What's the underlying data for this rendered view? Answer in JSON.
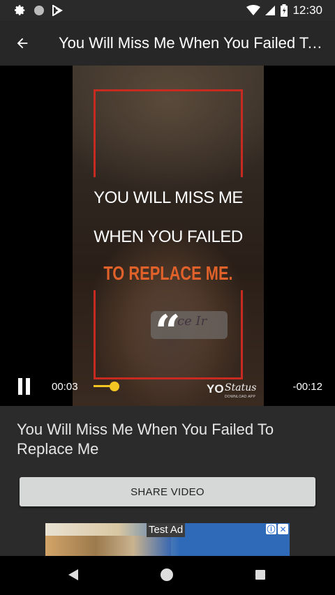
{
  "status_bar": {
    "time": "12:30",
    "left_icons": [
      "gear-icon",
      "circle-icon",
      "notification-icon"
    ],
    "right_icons": [
      "wifi-icon",
      "signal-icon",
      "battery-icon"
    ]
  },
  "app_bar": {
    "back_icon": "arrow-left-icon",
    "title": "You Will Miss Me When You Failed To Replace Me"
  },
  "video": {
    "overlay_lines": [
      "YOU WILL MISS ME",
      "WHEN YOU FAILED",
      "TO REPLACE ME."
    ],
    "quote_mark": "“",
    "shirt_text": "ce Ir",
    "elapsed": "00:03",
    "remaining": "-00:12",
    "progress_fraction": 0.2,
    "watermark": {
      "brand": "YO",
      "script": "Status",
      "sub": "DOWNLOAD APP"
    },
    "accent_color": "#f3c623",
    "frame_color": "#c62a20"
  },
  "content": {
    "video_title": "You Will Miss Me When You Failed To Replace Me",
    "share_label": "SHARE VIDEO"
  },
  "ad": {
    "label": "Test Ad",
    "info_icon": "ⓘ",
    "close_icon": "✕"
  },
  "nav_bar": {
    "icons": [
      "back-triangle-icon",
      "home-circle-icon",
      "recents-square-icon"
    ]
  }
}
